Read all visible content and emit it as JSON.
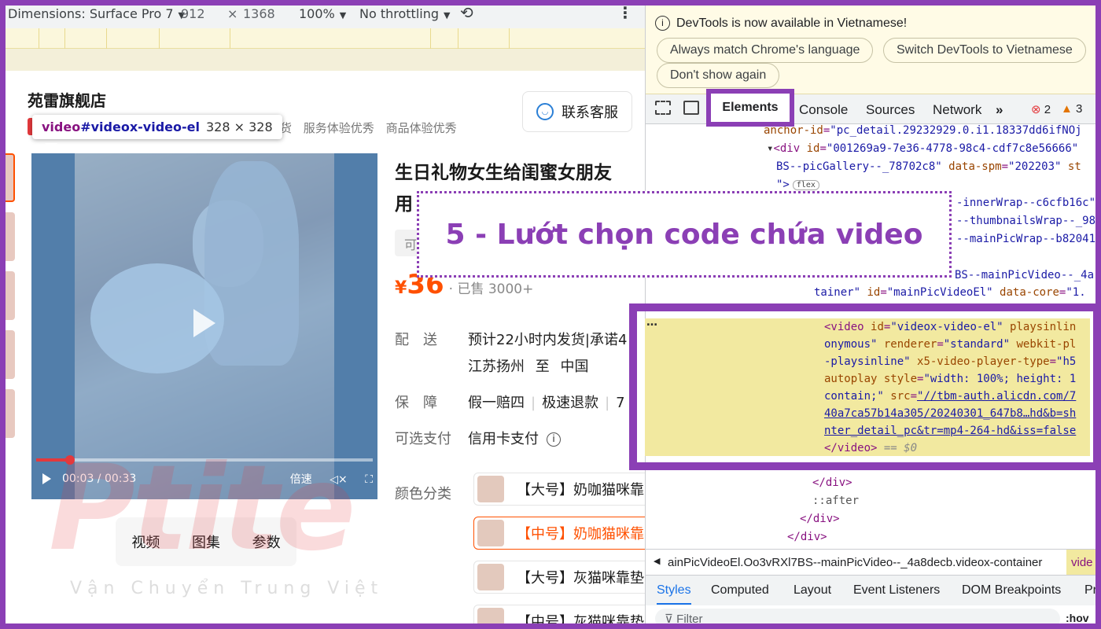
{
  "device_toolbar": {
    "dimensions_label": "Dimensions: Surface Pro 7",
    "width": "912",
    "times": "×",
    "height": "1368",
    "zoom": "100%",
    "throttle": "No throttling"
  },
  "shop": {
    "title": "苑雷旗舰店",
    "badges": [
      "发货",
      "服务体验优秀",
      "商品体验优秀"
    ],
    "contact_button": "联系客服"
  },
  "tooltip": {
    "tag": "video",
    "selector": "#videox-video-el",
    "size": "328 × 328"
  },
  "video": {
    "time": "00:03 / 00:33",
    "speed": "倍速",
    "progress_fraction": 0.1
  },
  "media_tabs": [
    "视频",
    "图集",
    "参数"
  ],
  "watermark": {
    "logo": "Ptite",
    "sub": "Vận Chuyển Trung Việt"
  },
  "product": {
    "title_line1": "生日礼物女生给闺蜜女朋友",
    "title_line2": "用",
    "chip": "可",
    "currency": "¥",
    "price": "36",
    "sold": "· 已售 3000+",
    "delivery_label": "配　送",
    "delivery_value": "预计22小时内发货|承诺4",
    "route_from": "江苏扬州",
    "route_to_word": "至",
    "route_to": "中国",
    "guarantee_label": "保　障",
    "guarantee_1": "假一赔四",
    "guarantee_2": "极速退款",
    "guarantee_3": "7",
    "payment_label": "可选支付",
    "payment_value": "信用卡支付",
    "color_label": "颜色分类",
    "options": [
      "【大号】奶咖猫咪靠",
      "【中号】奶咖猫咪靠",
      "【大号】灰猫咪靠垫",
      "【中号】灰猫咪靠垫"
    ]
  },
  "callout": "5 - Lướt chọn code chứa video",
  "devtools": {
    "notice": "DevTools is now available in Vietnamese!",
    "btn_match": "Always match Chrome's language",
    "btn_switch": "Switch DevTools to Vietnamese",
    "btn_dont": "Don't show again",
    "tabs": [
      "Elements",
      "Console",
      "Sources",
      "Network"
    ],
    "more": "»",
    "errors": "2",
    "warnings": "3",
    "dom": {
      "l1_attr": "anchor-id",
      "l1_val": "\"pc_detail.29232929.0.i1.18337dd6ifNOj",
      "l2_tag": "<div",
      "l2_attr": "id",
      "l2_val": "\"001269a9-7e36-4778-98c4-cdf7c8e56666\"",
      "l3_val": "BS--picGallery--_78702c8\"",
      "l3_attr": "data-spm",
      "l3_val2": "\"202203\"",
      "l3_tail": "st",
      "l4_tag": "\">",
      "flex": "flex",
      "l5": "-innerWrap--c6cfb16c\"",
      "l6": "--thumbnailsWrap--_98",
      "l7": "--mainPicWrap--b82041",
      "l8": "BS--mainPicVideo--_4a",
      "l9_a": "tainer\"",
      "l9_attr": "id",
      "l9_val": "\"mainPicVideoEl\"",
      "l9_attr2": "data-core",
      "l9_val2": "\"1.",
      "c1_tag": "<video",
      "c1_attr": "id",
      "c1_val": "\"videox-video-el\"",
      "c1_attr2": "playsinlin",
      "c2": "onymous\"",
      "c2_attr": "renderer",
      "c2_val": "\"standard\"",
      "c2_attr2": "webkit-pl",
      "c3": "-playsinline\"",
      "c3_attr": "x5-video-player-type",
      "c3_val": "\"h5",
      "c4_attr": "autoplay style",
      "c4_val": "\"width: 100%; height: 1",
      "c5_val": "contain;\"",
      "c5_attr": "src",
      "c5_url": "\"//tbm-auth.alicdn.com/7",
      "c6_url": "40a7ca57b14a305/20240301_647b8…hd&b=sh",
      "c7_url": "nter_detail_pc&tr=mp4-264-hd&iss=false",
      "c8_tag": "</video>",
      "c8_eq": "== $0",
      "close_div1": "</div>",
      "after": "::after",
      "close_div2": "</div>",
      "close_div3": "</div>"
    },
    "breadcrumb": "ainPicVideoEl.Oo3vRXl7BS--mainPicVideo--_4a8decb.videox-container",
    "breadcrumb_last": "vide",
    "styles_tabs": [
      "Styles",
      "Computed",
      "Layout",
      "Event Listeners",
      "DOM Breakpoints",
      "Pr"
    ],
    "filter_placeholder": "Filter",
    "hov": ":hov"
  },
  "colors": {
    "accent_purple": "#8b3fb5",
    "price_orange": "#ff5000",
    "highlight_yellow": "#f2e9a0"
  }
}
